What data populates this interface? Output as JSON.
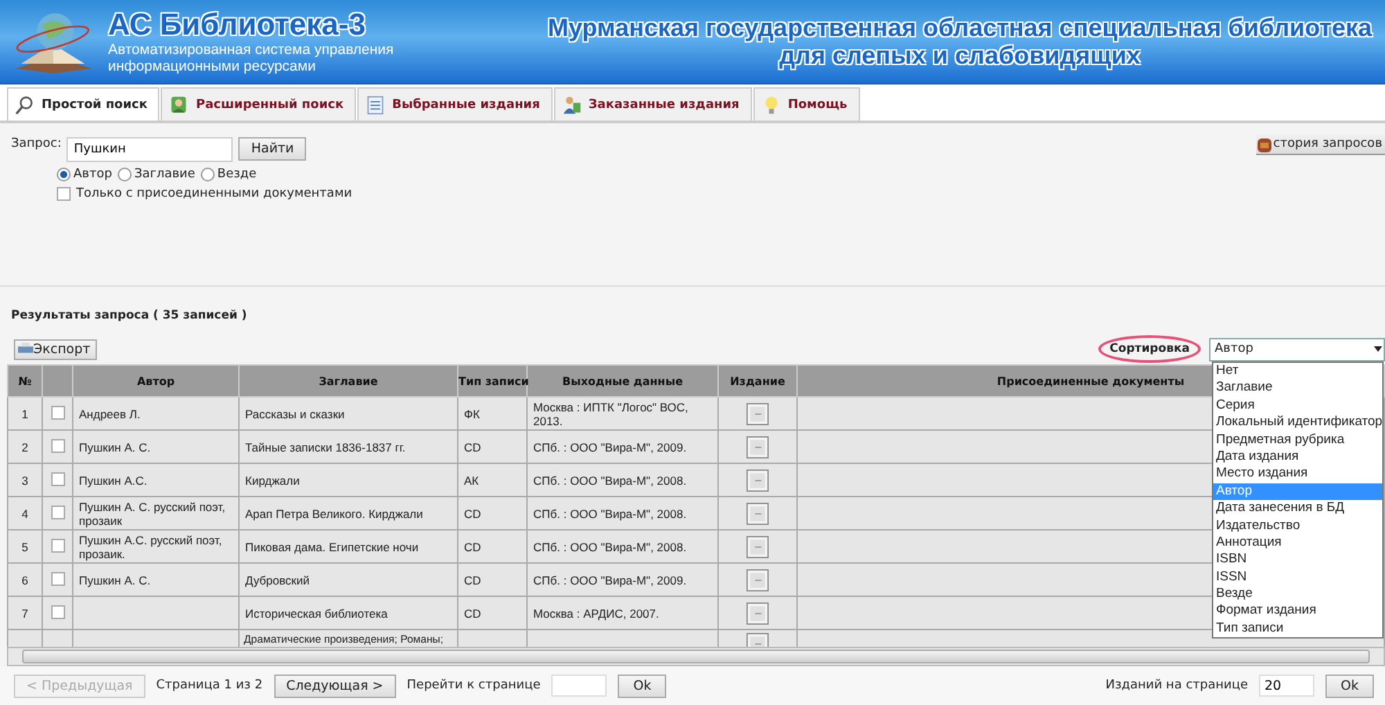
{
  "header": {
    "title": "АС Библиотека-3",
    "subtitle_lines": [
      "Автоматизированная система управления",
      "информационными ресурсами"
    ],
    "org_lines": [
      "Мурманская государственная областная специальная библиотека",
      "для слепых и слабовидящих"
    ]
  },
  "tabs": [
    {
      "label": "Простой поиск",
      "selected": true
    },
    {
      "label": "Расширенный поиск",
      "selected": false
    },
    {
      "label": "Выбранные издания",
      "selected": false
    },
    {
      "label": "Заказанные издания",
      "selected": false
    },
    {
      "label": "Помощь",
      "selected": false
    }
  ],
  "search": {
    "label": "Запрос:",
    "value": "Пушкин",
    "button": "Найти",
    "history_button": "стория запросов",
    "radios": [
      {
        "label": "Автор",
        "selected": true
      },
      {
        "label": "Заглавие",
        "selected": false
      },
      {
        "label": "Везде",
        "selected": false
      }
    ],
    "checkbox": {
      "label": "Только с присоединенными документами",
      "checked": false
    }
  },
  "results": {
    "title": "Результаты запроса ( 35 записей )",
    "export_button": "Экспорт",
    "sort_label": "Сортировка",
    "sort_highlighted": true,
    "sort_value": "Автор",
    "sort_options": [
      {
        "label": "Нет",
        "selected": false
      },
      {
        "label": "Заглавие",
        "selected": false
      },
      {
        "label": "Серия",
        "selected": false
      },
      {
        "label": "Локальный идентификатор",
        "selected": false
      },
      {
        "label": "Предметная рубрика",
        "selected": false
      },
      {
        "label": "Дата издания",
        "selected": false
      },
      {
        "label": "Место издания",
        "selected": false
      },
      {
        "label": "Автор",
        "selected": true
      },
      {
        "label": "Дата занесения в БД",
        "selected": false
      },
      {
        "label": "Издательство",
        "selected": false
      },
      {
        "label": "Аннотация",
        "selected": false
      },
      {
        "label": "ISBN",
        "selected": false
      },
      {
        "label": "ISSN",
        "selected": false
      },
      {
        "label": "Везде",
        "selected": false
      },
      {
        "label": "Формат издания",
        "selected": false
      },
      {
        "label": "Тип записи",
        "selected": false
      }
    ],
    "columns": [
      "№",
      "Автор",
      "Заглавие",
      "Тип записи",
      "Выходные данные",
      "Издание",
      "Присоединенные документы"
    ],
    "rows": [
      {
        "number": "1",
        "checked": false,
        "author": "Андреев Л.",
        "title": "Рассказы и сказки",
        "type": "ФК",
        "imprint": "Москва : ИПТК \"Логос\" ВОС, 2013."
      },
      {
        "number": "2",
        "checked": false,
        "author": "Пушкин А. С.",
        "title": "Тайные записки 1836-1837 гг.",
        "type": "CD",
        "imprint": "СПб. : ООО \"Вира-М\", 2009."
      },
      {
        "number": "3",
        "checked": false,
        "author": "Пушкин А.С.",
        "title": "Кирджали",
        "type": "АК",
        "imprint": "СПб. : ООО \"Вира-М\", 2008."
      },
      {
        "number": "4",
        "checked": false,
        "author": "Пушкин А. С. русский поэт, прозаик",
        "title": "Арап Петра Великого. Кирджали",
        "type": "CD",
        "imprint": "СПб. : ООО \"Вира-М\", 2008."
      },
      {
        "number": "5",
        "checked": false,
        "author": "Пушкин А.С. русский поэт, прозаик.",
        "title": "Пиковая дама. Египетские ночи",
        "type": "CD",
        "imprint": "СПб. : ООО \"Вира-М\", 2008."
      },
      {
        "number": "6",
        "checked": false,
        "author": "Пушкин А. С.",
        "title": "Дубровский",
        "type": "CD",
        "imprint": "СПб. : ООО \"Вира-М\", 2009."
      },
      {
        "number": "7",
        "checked": false,
        "author": "",
        "title": "Историческая библиотека",
        "type": "CD",
        "imprint": "Москва : АРДИС, 2007."
      },
      {
        "number": "",
        "author": "",
        "title": "Драматические произведения; Романы;",
        "type": "",
        "imprint": ""
      }
    ]
  },
  "pagination": {
    "prev_button": "< Предыдущая",
    "prev_disabled": true,
    "page_info": "Страница 1 из 2",
    "next_button": "Следующая >",
    "goto_label": "Перейти к странице",
    "goto_button": "Ok",
    "per_page_label": "Изданий на странице",
    "per_page_value": "20",
    "per_page_button": "Ok"
  }
}
